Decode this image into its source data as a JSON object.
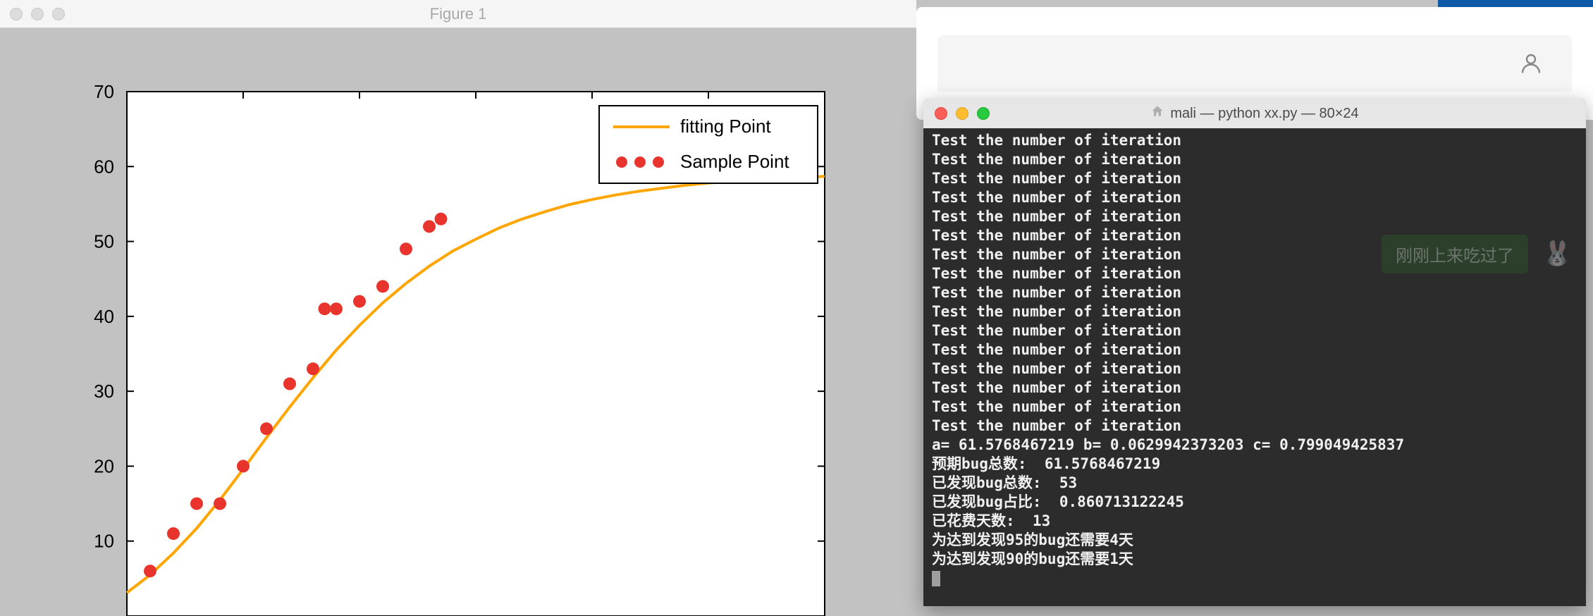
{
  "figure": {
    "window_title": "Figure 1",
    "legend": {
      "fitting": "fitting Point",
      "sample": "Sample Point"
    },
    "yticks": [
      "10",
      "20",
      "30",
      "40",
      "50",
      "60",
      "70"
    ]
  },
  "chart_data": {
    "type": "line+scatter",
    "title": "",
    "xlabel": "",
    "ylabel": "",
    "xlim": [
      0,
      30
    ],
    "ylim": [
      0,
      70
    ],
    "series": [
      {
        "name": "fitting Point",
        "kind": "line",
        "color": "#ffa500",
        "fit_params": {
          "a": 61.5768467219,
          "b": 0.0629942373203,
          "c": 0.799049425837
        },
        "x": [
          0,
          1,
          2,
          3,
          4,
          5,
          6,
          7,
          8,
          9,
          10,
          11,
          12,
          13,
          14,
          15,
          16,
          17,
          18,
          19,
          20,
          21,
          22,
          23,
          24,
          25,
          26,
          27,
          28,
          29,
          30
        ],
        "y": [
          3.1,
          5.5,
          8.4,
          11.7,
          15.5,
          19.6,
          23.8,
          27.9,
          31.8,
          35.5,
          38.8,
          41.8,
          44.4,
          46.7,
          48.7,
          50.3,
          51.8,
          53.0,
          54.0,
          54.9,
          55.6,
          56.2,
          56.7,
          57.1,
          57.5,
          57.8,
          58.0,
          58.2,
          58.4,
          58.5,
          58.7
        ]
      },
      {
        "name": "Sample Point",
        "kind": "scatter",
        "color": "#e8342c",
        "x": [
          1,
          2,
          3,
          4,
          5,
          6,
          7,
          8,
          9,
          10,
          11,
          12,
          13
        ],
        "y": [
          6,
          11,
          15,
          15,
          20,
          25,
          31,
          33,
          41,
          42,
          44,
          49,
          52
        ]
      },
      {
        "name": "Sample Point (secondary)",
        "kind": "scatter",
        "color": "#e8342c",
        "x": [
          8.5,
          13.5
        ],
        "y": [
          41,
          53
        ]
      }
    ]
  },
  "terminal": {
    "title_prefix": "mali — python xx.py — 80×24",
    "lines": [
      "Test the number of iteration",
      "Test the number of iteration",
      "Test the number of iteration",
      "Test the number of iteration",
      "Test the number of iteration",
      "Test the number of iteration",
      "Test the number of iteration",
      "Test the number of iteration",
      "Test the number of iteration",
      "Test the number of iteration",
      "Test the number of iteration",
      "Test the number of iteration",
      "Test the number of iteration",
      "Test the number of iteration",
      "Test the number of iteration",
      "Test the number of iteration",
      "a= 61.5768467219 b= 0.0629942373203 c= 0.799049425837",
      "预期bug总数:  61.5768467219",
      "已发现bug总数:  53",
      "已发现bug占比:  0.860713122245",
      "已花费天数:  13",
      "为达到发现95的bug还需要4天",
      "为达到发现90的bug还需要1天"
    ]
  },
  "background": {
    "notif_text": "刚刚上来吃过了"
  }
}
